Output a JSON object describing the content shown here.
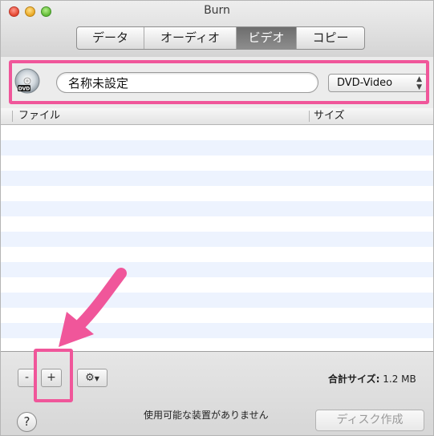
{
  "window": {
    "title": "Burn"
  },
  "tabs": [
    {
      "label": "データ",
      "active": false
    },
    {
      "label": "オーディオ",
      "active": false
    },
    {
      "label": "ビデオ",
      "active": true
    },
    {
      "label": "コピー",
      "active": false
    }
  ],
  "disc": {
    "icon": "dvd-disc-icon",
    "icon_text": "DVD",
    "name_value": "名称未設定",
    "format_selected": "DVD-Video"
  },
  "table": {
    "columns": [
      "ファイル",
      "サイズ"
    ],
    "rows": []
  },
  "bottom": {
    "remove_label": "-",
    "add_label": "+",
    "gear_icon": "gear-icon",
    "total_label": "合計サイズ:",
    "total_value": "1.2 MB",
    "help_label": "?",
    "status_text": "使用可能な装置がありません",
    "burn_label": "ディスク作成"
  },
  "colors": {
    "annotation": "#f0569a",
    "tab_active": "#7a7a7a",
    "row_stripe": "#edf3fe"
  }
}
